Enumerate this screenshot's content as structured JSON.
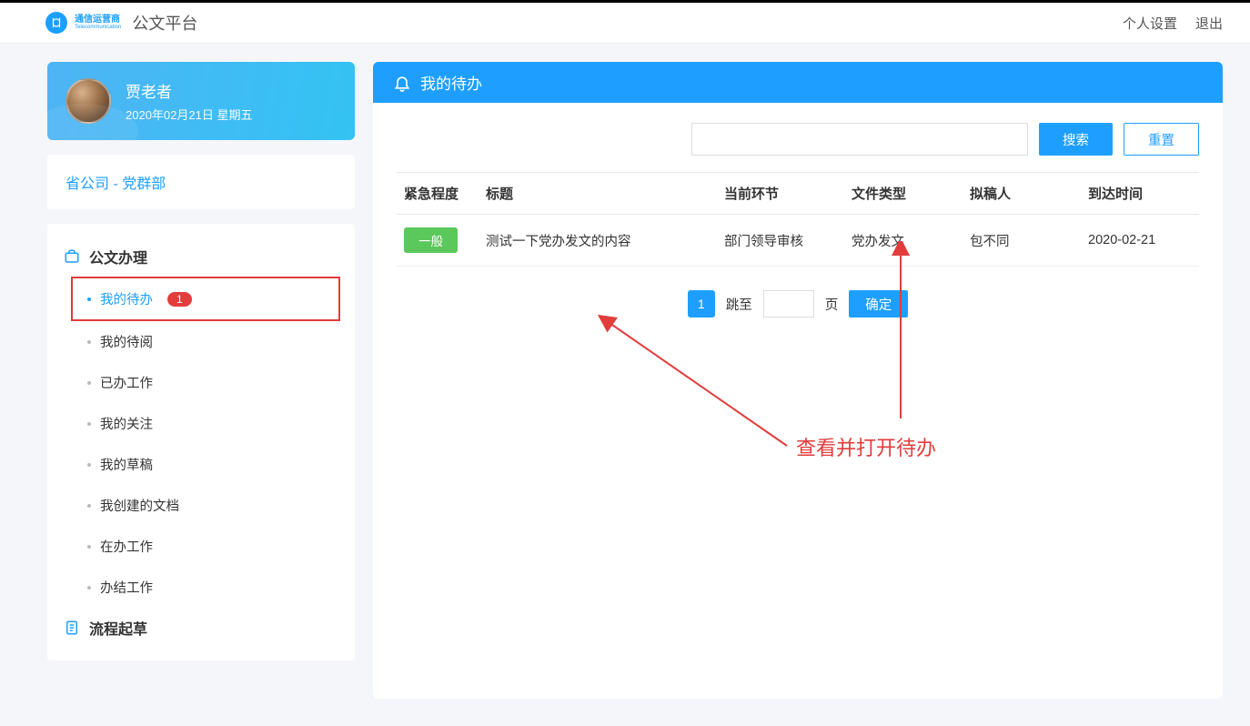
{
  "header": {
    "brand_cn": "通信运营商",
    "brand_en": "Telecommunication",
    "app_title": "公文平台",
    "links": {
      "settings": "个人设置",
      "logout": "退出"
    }
  },
  "profile": {
    "name": "贾老者",
    "date": "2020年02月21日 星期五"
  },
  "org": "省公司 - 党群部",
  "menu": {
    "section1": {
      "title": "公文办理",
      "items": [
        {
          "label": "我的待办",
          "badge": "1"
        },
        {
          "label": "我的待阅"
        },
        {
          "label": "已办工作"
        },
        {
          "label": "我的关注"
        },
        {
          "label": "我的草稿"
        },
        {
          "label": "我创建的文档"
        },
        {
          "label": "在办工作"
        },
        {
          "label": "办结工作"
        }
      ]
    },
    "section2": {
      "title": "流程起草"
    }
  },
  "panel": {
    "title": "我的待办",
    "search_btn": "搜索",
    "reset_btn": "重置",
    "columns": {
      "urgency": "紧急程度",
      "title": "标题",
      "stage": "当前环节",
      "filetype": "文件类型",
      "drafter": "拟稿人",
      "arrived": "到达时间"
    },
    "rows": [
      {
        "urgency": "一般",
        "title": "测试一下党办发文的内容",
        "stage": "部门领导审核",
        "filetype": "党办发文",
        "drafter": "包不同",
        "arrived": "2020-02-21"
      }
    ],
    "pagination": {
      "current": "1",
      "jump_label": "跳至",
      "page_label": "页",
      "confirm": "确定"
    }
  },
  "annotation": {
    "text": "查看并打开待办"
  }
}
